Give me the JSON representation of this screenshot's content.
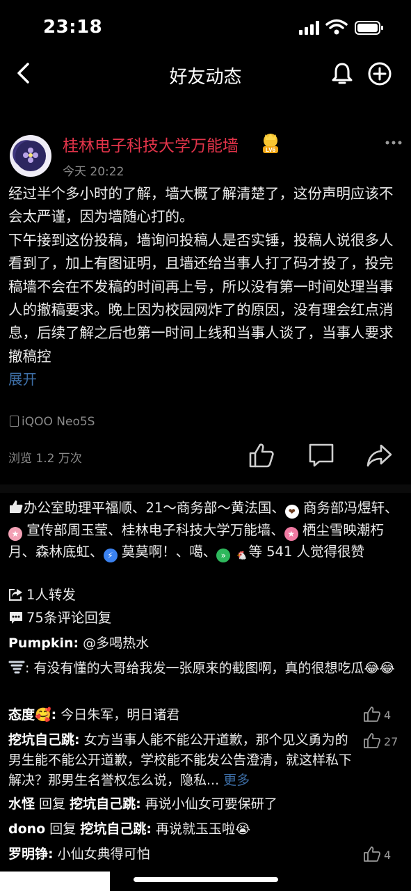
{
  "status_bar": {
    "time": "23:18"
  },
  "nav": {
    "title": "好友动态"
  },
  "post": {
    "author": "桂林电子科技大学万能墙",
    "level_badge": "LV6",
    "time": "今天 20:22",
    "paragraph1": "经过半个多小时的了解，墙大概了解清楚了，这份声明应该不会太严谨，因为墙随心打的。",
    "paragraph2": "下午接到这份投稿，墙询问投稿人是否实锤，投稿人说很多人看到了，加上有图证明，且墙还给当事人打了码才投了，投完稿墙不会在不发稿的时间再上号，所以没有第一时间处理当事人的撤稿要求。晚上因为校园网炸了的原因，没有理会红点消息，后续了解之后也第一时间上线和当事人谈了，当事人要求撤稿控",
    "expand": "展开",
    "device": "iQOO Neo5S",
    "views": "浏览 1.2 万次"
  },
  "likes": {
    "n1": "办公室助理平福顺、21～商务部～黄法国、",
    "n2": "商务部冯煜轩、",
    "n3": "宣传部周玉莹、桂林电子科技大学万能墙、",
    "n4": "栖尘雪映潮朽月、森林底虹、",
    "n5": "莫莫啊！、噶、",
    "n6": "等 541 人觉得很赞"
  },
  "shares": "1人转发",
  "comments_count": "75条评论回复",
  "comments": [
    {
      "name": "Pumpkin:",
      "text": " @多喝热水",
      "likes": ""
    },
    {
      "name": "",
      "text": ": 有没有懂的大哥给我发一张原来的截图啊，真的很想吃瓜😂😂",
      "likes": ""
    },
    {
      "name": "态度🥰:",
      "text": " 今日朱军，明日诸君",
      "likes": "4"
    },
    {
      "name": "挖坑自己跳:",
      "text": " 女方当事人能不能公开道歉，那个见义勇为的男生能不能公开道歉，学校能不能发公告澄清，就这样私下解决？那男生名誉权怎么说，隐私...",
      "more": " 更多",
      "likes": "27"
    },
    {
      "name": "水怪",
      "mid": " 回复 ",
      "name2": "挖坑自己跳:",
      "text": " 再说小仙女可要保研了",
      "likes": ""
    },
    {
      "name": "dono",
      "mid": " 回复 ",
      "name2": "挖坑自己跳:",
      "text": " 再说就玉玉啦😭",
      "likes": ""
    },
    {
      "name": "罗明铮:",
      "text": " 小仙女典得可怕",
      "likes": "4"
    }
  ]
}
